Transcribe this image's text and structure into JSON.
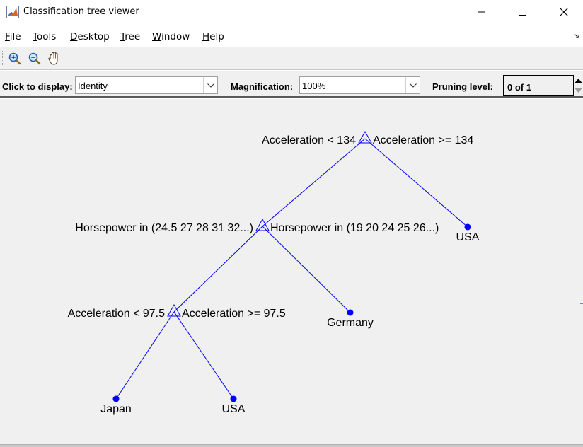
{
  "window": {
    "title": "Classification tree viewer"
  },
  "menu": {
    "items": [
      {
        "key": "F",
        "rest": "ile"
      },
      {
        "key": "T",
        "rest": "ools"
      },
      {
        "key": "D",
        "rest": "esktop"
      },
      {
        "key": "T",
        "rest": "ree"
      },
      {
        "key": "W",
        "rest": "indow"
      },
      {
        "key": "H",
        "rest": "elp"
      }
    ]
  },
  "toolbar": {
    "icons": [
      "zoom-in-icon",
      "zoom-out-icon",
      "pan-hand-icon"
    ]
  },
  "controls": {
    "click_label": "Click to display:",
    "click_value": "Identity",
    "magnification_label": "Magnification:",
    "magnification_value": "100%",
    "pruning_label": "Pruning level:",
    "pruning_value": "0 of 1"
  },
  "tree": {
    "nodes": [
      {
        "id": "root",
        "type": "branch",
        "left_rule": "Acceleration < 134",
        "right_rule": "Acceleration >= 134"
      },
      {
        "id": "n2",
        "type": "branch",
        "left_rule": "Horsepower in (24.5 27 28 31 32...)",
        "right_rule": "Horsepower in (19 20 24 25 26...)"
      },
      {
        "id": "n3",
        "type": "leaf",
        "label": "USA"
      },
      {
        "id": "n4",
        "type": "branch",
        "left_rule": "Acceleration < 97.5",
        "right_rule": "Acceleration >= 97.5"
      },
      {
        "id": "n5",
        "type": "leaf",
        "label": "Germany"
      },
      {
        "id": "n6",
        "type": "leaf",
        "label": "Japan"
      },
      {
        "id": "n7",
        "type": "leaf",
        "label": "USA"
      }
    ],
    "colors": {
      "edge": "#0000ff",
      "leaf": "#0000ff",
      "text": "#000000"
    }
  }
}
